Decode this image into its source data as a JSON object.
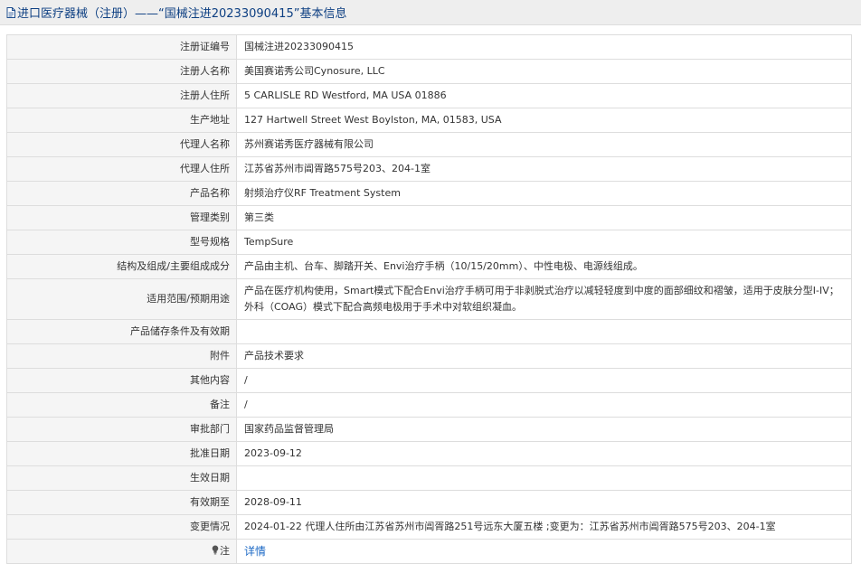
{
  "header": {
    "title": "进口医疗器械（注册）——“国械注进20233090415”基本信息",
    "title_icon": "document-icon"
  },
  "rows": [
    {
      "key": "reg_no",
      "label": "注册证编号",
      "value": "国械注进20233090415"
    },
    {
      "key": "registrant_name",
      "label": "注册人名称",
      "value": "美国赛诺秀公司Cynosure, LLC"
    },
    {
      "key": "registrant_address",
      "label": "注册人住所",
      "value": "5 CARLISLE RD Westford, MA USA 01886"
    },
    {
      "key": "production_address",
      "label": "生产地址",
      "value": "127 Hartwell Street West Boylston, MA, 01583, USA"
    },
    {
      "key": "agent_name",
      "label": "代理人名称",
      "value": "苏州赛诺秀医疗器械有限公司"
    },
    {
      "key": "agent_address",
      "label": "代理人住所",
      "value": "江苏省苏州市阊胥路575号203、204-1室"
    },
    {
      "key": "product_name",
      "label": "产品名称",
      "value": "射频治疗仪RF Treatment System"
    },
    {
      "key": "category",
      "label": "管理类别",
      "value": "第三类"
    },
    {
      "key": "model",
      "label": "型号规格",
      "value": "TempSure"
    },
    {
      "key": "structure",
      "label": "结构及组成/主要组成成分",
      "value": "产品由主机、台车、脚踏开关、Envi治疗手柄（10/15/20mm）、中性电极、电源线组成。"
    },
    {
      "key": "intended_use",
      "label": "适用范围/预期用途",
      "value": "产品在医疗机构使用，Smart模式下配合Envi治疗手柄可用于非剥脱式治疗以减轻轻度到中度的面部细纹和褶皱，适用于皮肤分型I-IV；外科（COAG）模式下配合高频电极用于手术中对软组织凝血。"
    },
    {
      "key": "storage",
      "label": "产品储存条件及有效期",
      "value": ""
    },
    {
      "key": "attachment",
      "label": "附件",
      "value": "产品技术要求"
    },
    {
      "key": "other",
      "label": "其他内容",
      "value": "/"
    },
    {
      "key": "remark",
      "label": "备注",
      "value": "/"
    },
    {
      "key": "approval_dept",
      "label": "审批部门",
      "value": "国家药品监督管理局"
    },
    {
      "key": "approval_date",
      "label": "批准日期",
      "value": "2023-09-12"
    },
    {
      "key": "effective_date",
      "label": "生效日期",
      "value": ""
    },
    {
      "key": "expiry_date",
      "label": "有效期至",
      "value": "2028-09-11"
    },
    {
      "key": "changes",
      "label": "变更情况",
      "value": "2024-01-22 代理人住所由江苏省苏州市阊胥路251号远东大厦五楼 ;变更为：江苏省苏州市阊胥路575号203、204-1室"
    }
  ],
  "note_row": {
    "label": "注",
    "icon": "lightbulb-icon",
    "link_text": "详情"
  },
  "colors": {
    "header_bg": "#eeeeee",
    "title_color": "#0d3f82",
    "label_bg": "#f5f5f5",
    "border": "#dddddd",
    "link": "#1b68c5"
  }
}
